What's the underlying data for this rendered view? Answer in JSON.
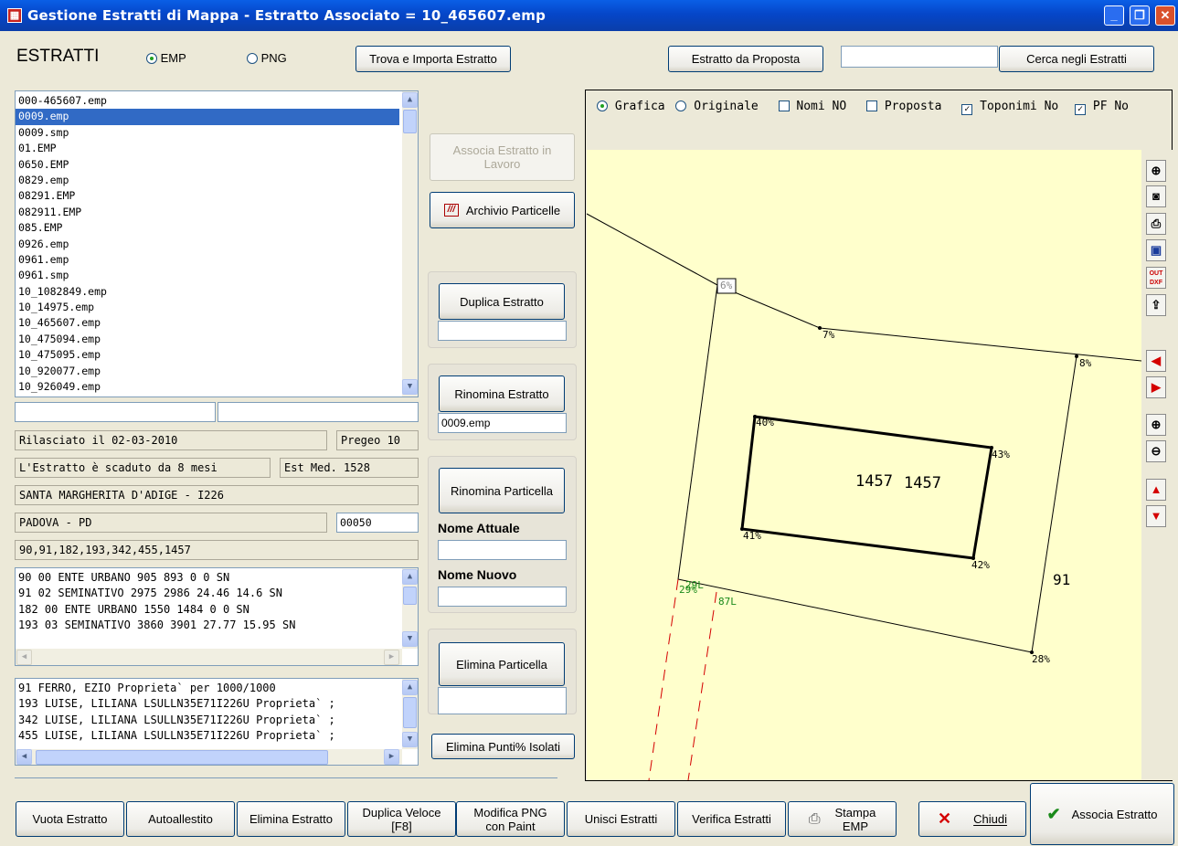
{
  "window": {
    "title": "Gestione Estratti di Mappa - Estratto Associato = 10_465607.emp",
    "app_icon": "grid-icon"
  },
  "top": {
    "section_label": "ESTRATTI",
    "radio_emp": "EMP",
    "radio_png": "PNG",
    "find_import": "Trova e Importa Estratto",
    "from_proposal": "Estratto da Proposta",
    "search_value": "",
    "search_button": "Cerca negli Estratti"
  },
  "files": [
    "000-465607.emp",
    "0009.emp",
    "0009.smp",
    "01.EMP",
    "0650.EMP",
    "0829.emp",
    "08291.EMP",
    "082911.EMP",
    "085.EMP",
    "0926.emp",
    "0961.emp",
    "0961.smp",
    "10_1082849.emp",
    "10_14975.emp",
    "10_465607.emp",
    "10_475094.emp",
    "10_475095.emp",
    "10_920077.emp",
    "10_926049.emp"
  ],
  "selected_file": "0009.emp",
  "info": {
    "released": "Rilasciato il 02-03-2010",
    "pregeo": "Pregeo 10",
    "expired": "L'Estratto è scaduto da 8 mesi",
    "est_med": "Est Med. 1528",
    "municipality": "SANTA MARGHERITA D'ADIGE - I226",
    "province": "PADOVA - PD",
    "code": "00050",
    "parcels": "90,91,182,193,342,455,1457"
  },
  "parcel_rows": [
    "90 00 ENTE URBANO  905 893 0 0 SN",
    "91 02 SEMINATIVO   2975 2986 24.46 14.6 SN",
    "182 00 ENTE URBANO  1550 1484 0 0 SN",
    "193 03 SEMINATIVO   3860 3901 27.77 15.95 SN"
  ],
  "owner_rows": [
    "91 FERRO, EZIO  Proprieta` per 1000/1000",
    "193 LUISE, LILIANA LSULLN35E71I226U Proprieta` ;",
    "342 LUISE, LILIANA LSULLN35E71I226U Proprieta` ;",
    "455 LUISE, LILIANA LSULLN35E71I226U Proprieta` ;"
  ],
  "middle": {
    "associate_work": "Associa Estratto in Lavoro",
    "archive": "Archivio Particelle",
    "duplicate": "Duplica Estratto",
    "duplicate_value": "",
    "rename": "Rinomina Estratto",
    "rename_value": "0009.emp",
    "rename_parcel": "Rinomina Particella",
    "current_name": "Nome Attuale",
    "current_value": "",
    "new_name": "Nome Nuovo",
    "new_value": "",
    "delete_parcel": "Elimina Particella",
    "delete_value": "",
    "delete_points": "Elimina Punti% Isolati"
  },
  "map": {
    "opt_grafica": "Grafica",
    "opt_originale": "Originale",
    "nomi": "Nomi NO",
    "proposta": "Proposta",
    "toponimi": "Toponimi No",
    "pf": "PF No",
    "background": "#ffffcc",
    "points": [
      "6%",
      "7%",
      "8%",
      "40%",
      "43%",
      "41%",
      "42%",
      "29%",
      "28%",
      "87L",
      "29L"
    ],
    "labels": [
      "1457",
      "1457",
      "91"
    ],
    "tools": [
      "zoom-extent-icon",
      "camera-icon",
      "print-icon",
      "save-icon",
      "out-dxf-icon",
      "export-icon",
      "arrow-left-icon",
      "arrow-right-icon",
      "zoom-in-icon",
      "zoom-out-icon",
      "arrow-up-icon",
      "arrow-down-icon"
    ],
    "out_dxf_label": "OUT DXF"
  },
  "bottom": {
    "empty": "Vuota Estratto",
    "auto": "Autoallestito",
    "delete": "Elimina Estratto",
    "dup_fast_1": "Duplica Veloce",
    "dup_fast_2": "[F8]",
    "paint_1": "Modifica PNG",
    "paint_2": "con Paint",
    "merge": "Unisci Estratti",
    "verify": "Verifica Estratti",
    "print_1": "Stampa",
    "print_2": "EMP",
    "close": "Chiudi",
    "associate": "Associa Estratto"
  },
  "colors": {
    "titlebar": "#0546c9",
    "selection": "#316ac5",
    "map_bg": "#ffffcc",
    "close_x": "#d40000",
    "check_green": "#1a8a1a"
  }
}
